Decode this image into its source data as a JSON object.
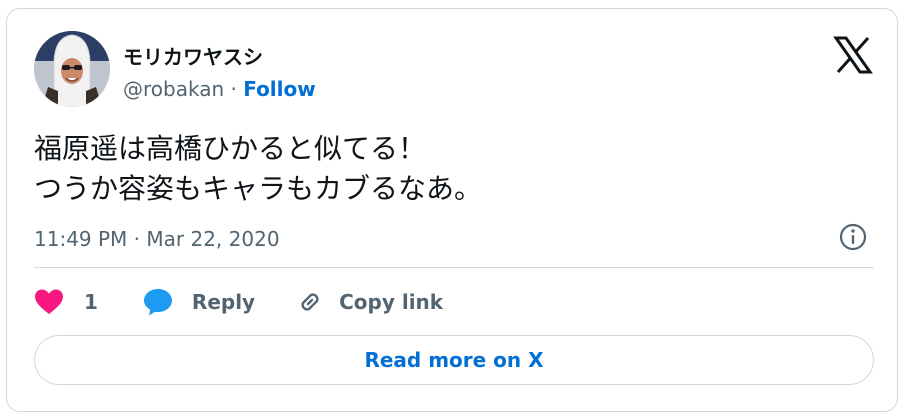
{
  "author": {
    "display_name": "モリカワヤスシ",
    "handle": "@robakan",
    "separator": " · ",
    "follow_label": "Follow"
  },
  "tweet": {
    "lines": [
      "福原遥は高橋ひかると似てる！",
      "つうか容姿もキャラもカブるなあ。"
    ],
    "timestamp": "11:49 PM · Mar 22, 2020"
  },
  "actions": {
    "like_count": "1",
    "reply_label": "Reply",
    "copy_link_label": "Copy link"
  },
  "read_more_label": "Read more on X",
  "colors": {
    "like": "#f91880",
    "reply": "#1d9bf0",
    "link": "#006fd6",
    "muted": "#536471",
    "border": "#cfd9de"
  }
}
